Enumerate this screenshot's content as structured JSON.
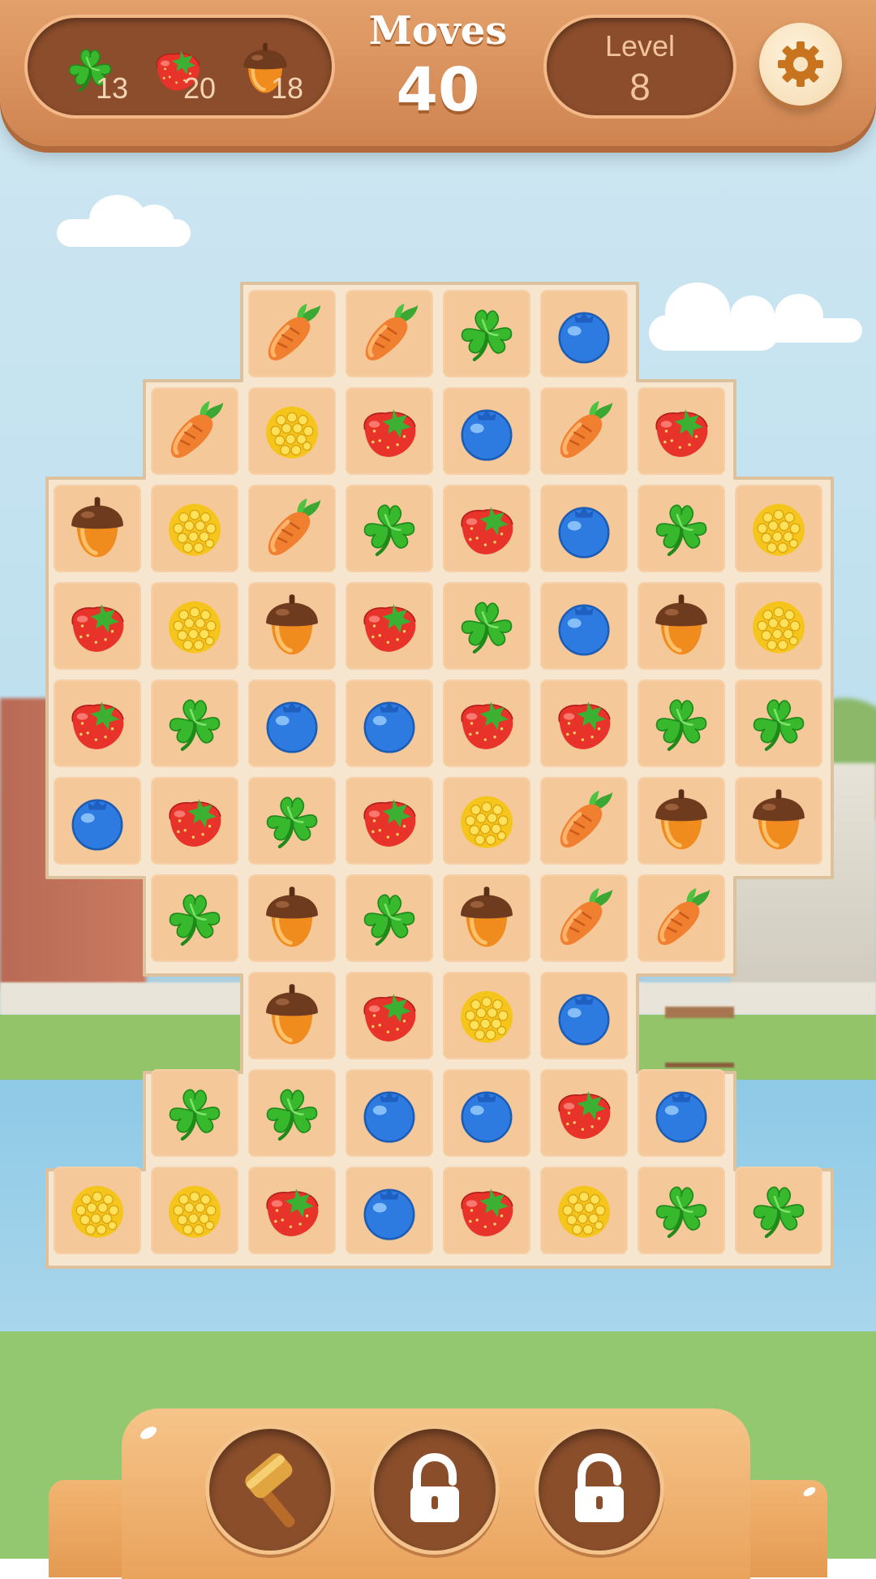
{
  "goals": [
    {
      "icon": "clover-icon",
      "count": "13"
    },
    {
      "icon": "strawberry-icon",
      "count": "20"
    },
    {
      "icon": "acorn-icon",
      "count": "18"
    }
  ],
  "moves": {
    "label": "Moves",
    "value": "40"
  },
  "level": {
    "label": "Level",
    "value": "8"
  },
  "settings": {
    "icon": "gear-icon"
  },
  "board": {
    "legend": {
      "C": "carrot",
      "L": "clover",
      "B": "blueberry",
      "S": "strawberry",
      "N": "corn",
      "A": "acorn"
    },
    "rows": [
      "..CCLB..",
      ".CNSBCS.",
      "ANCLSBLN",
      "SNASLBAN",
      "SLBBSSLL",
      "BSLSNCAA",
      ".LALACC.",
      "..ASNB..",
      ".LLBBSB.",
      "NNSBSNLL"
    ]
  },
  "boosters": [
    {
      "icon": "hammer-icon",
      "locked": false
    },
    {
      "icon": "lock-icon",
      "locked": true
    },
    {
      "icon": "lock-icon",
      "locked": true
    }
  ],
  "colors": {
    "wood": "#cf8450",
    "panel": "#8b4d2b",
    "tile": "#f4c899",
    "board_frame": "#f6e6cf"
  }
}
